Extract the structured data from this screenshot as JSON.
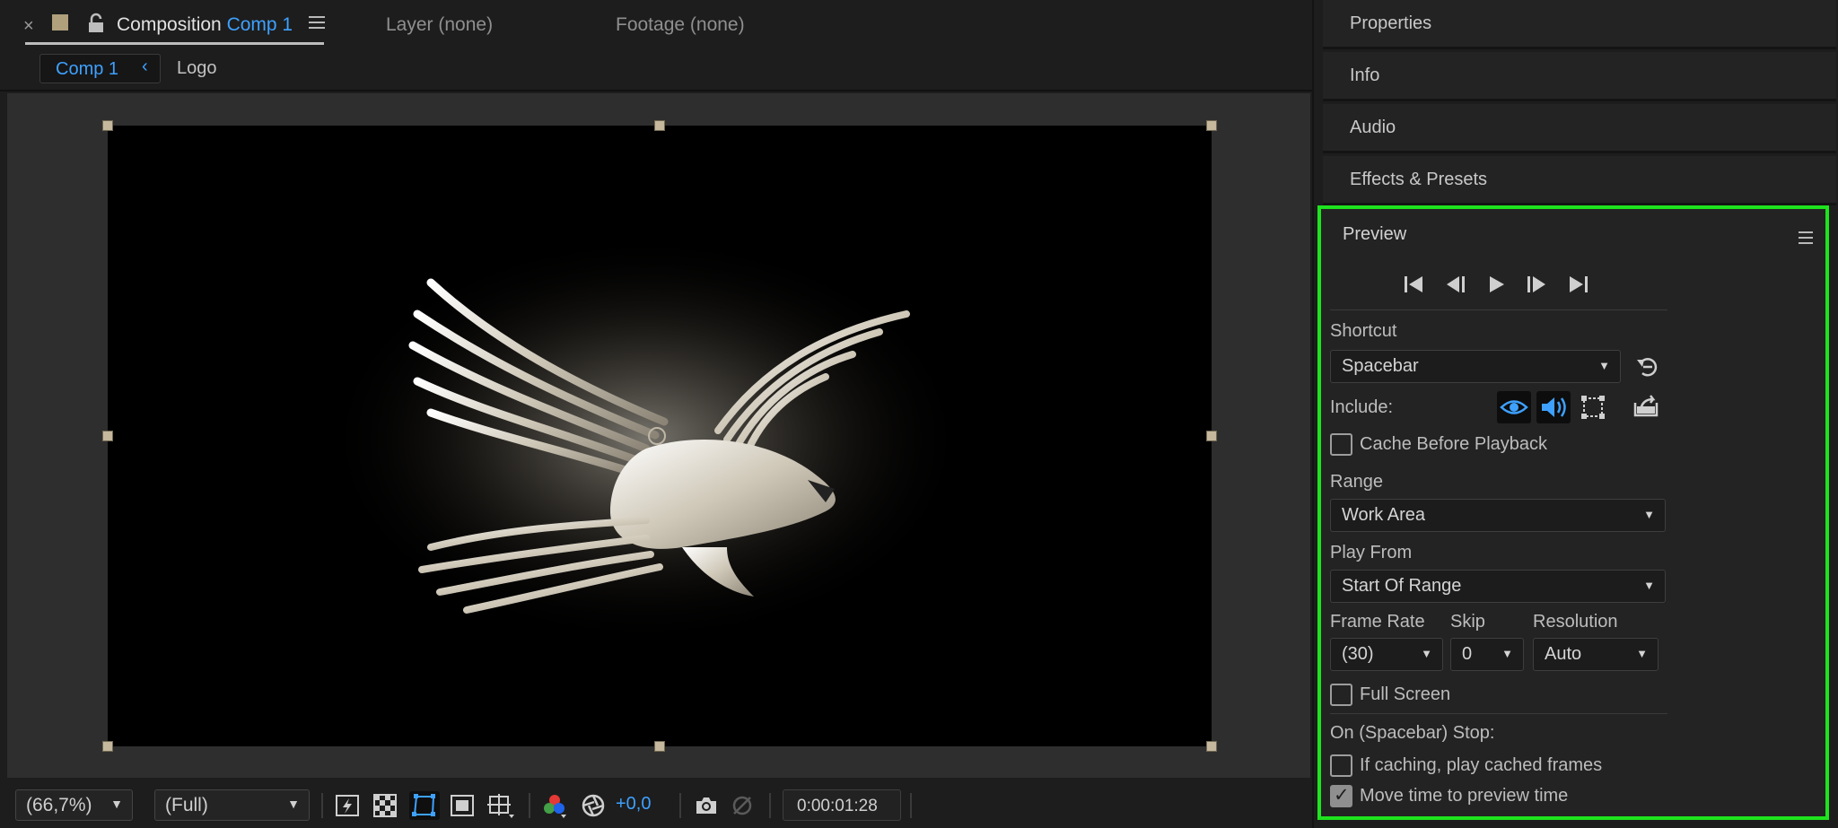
{
  "composition_panel": {
    "tab_prefix": "Composition",
    "tab_comp_name": "Comp 1",
    "layer_tab": "Layer (none)",
    "footage_tab": "Footage (none)",
    "breadcrumb": {
      "current": "Comp 1",
      "next": "Logo"
    }
  },
  "viewer_toolbar": {
    "zoom": "(66,7%)",
    "resolution": "(Full)",
    "exposure": "+0,0",
    "timecode": "0:00:01:28"
  },
  "panels": {
    "properties": "Properties",
    "info": "Info",
    "audio": "Audio",
    "effects_presets": "Effects & Presets"
  },
  "preview": {
    "title": "Preview",
    "shortcut_label": "Shortcut",
    "shortcut_value": "Spacebar",
    "include_label": "Include:",
    "cache_before_playback": "Cache Before Playback",
    "range_label": "Range",
    "range_value": "Work Area",
    "play_from_label": "Play From",
    "play_from_value": "Start Of Range",
    "frame_rate_label": "Frame Rate",
    "frame_rate_value": "(30)",
    "skip_label": "Skip",
    "skip_value": "0",
    "resolution_label": "Resolution",
    "resolution_value": "Auto",
    "full_screen": "Full Screen",
    "on_stop_label": "On (Spacebar) Stop:",
    "if_caching": "If caching, play cached frames",
    "move_time": "Move time to preview time",
    "checkboxes": {
      "cache_before_playback": false,
      "full_screen": false,
      "if_caching": false,
      "move_time": true
    }
  },
  "colors": {
    "accent_blue": "#3ea1ff",
    "highlight_green": "#1ee31e",
    "panel_bg": "#232323"
  }
}
